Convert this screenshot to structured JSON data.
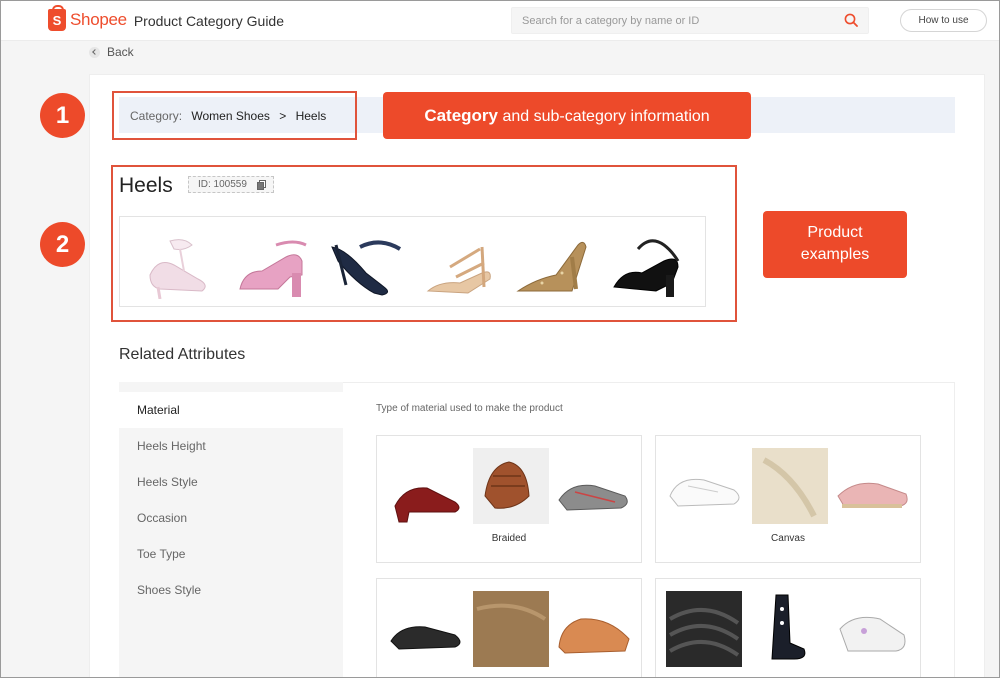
{
  "header": {
    "logo_text": "Shopee",
    "logo_letter": "S",
    "app_title": "Product Category Guide",
    "search_placeholder": "Search for a category by name or ID",
    "how_to_use": "How to use"
  },
  "back_label": "Back",
  "category": {
    "prefix": "Category:",
    "path": [
      "Women Shoes",
      "Heels"
    ],
    "separator": ">",
    "title": "Heels",
    "id_label": "ID: 100559"
  },
  "annotations": {
    "badge1": "1",
    "badge2": "2",
    "callout1_bold": "Category",
    "callout1_rest": " and sub-category information",
    "callout2_line1": "Product",
    "callout2_line2": "examples"
  },
  "related": {
    "title": "Related Attributes",
    "attributes": [
      "Material",
      "Heels Height",
      "Heels Style",
      "Occasion",
      "Toe Type",
      "Shoes Style"
    ],
    "active": "Material",
    "description": "Type of material used to make the product",
    "values": [
      "Braided",
      "Canvas",
      "",
      ""
    ]
  },
  "colors": {
    "brand": "#ee4d2d",
    "annotation": "#ed4a2a",
    "category_bar": "#edf1f8"
  },
  "icons": [
    "shopee-bag-icon",
    "search-icon",
    "back-arrow-icon",
    "copy-icon"
  ]
}
